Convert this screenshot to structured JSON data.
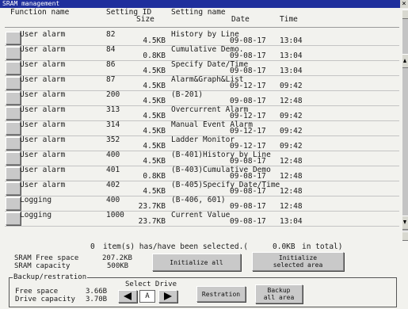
{
  "window": {
    "title": "SRAM management",
    "close_label": "×"
  },
  "header": {
    "function_name": "Function name",
    "setting_id": "Setting ID",
    "size": "Size",
    "setting_name": "Setting name",
    "date": "Date",
    "time": "Time"
  },
  "rows": [
    {
      "function": "User alarm",
      "id": "82",
      "size": "4.5KB",
      "name": "History by Line",
      "date": "09-08-17",
      "time": "13:04"
    },
    {
      "function": "User alarm",
      "id": "84",
      "size": "0.8KB",
      "name": "Cumulative Demo.",
      "date": "09-08-17",
      "time": "13:04"
    },
    {
      "function": "User alarm",
      "id": "86",
      "size": "4.5KB",
      "name": "Specify Date/Time",
      "date": "09-08-17",
      "time": "13:04"
    },
    {
      "function": "User alarm",
      "id": "87",
      "size": "4.5KB",
      "name": "Alarm&Graph&List",
      "date": "09-12-17",
      "time": "09:42"
    },
    {
      "function": "User alarm",
      "id": "200",
      "size": "4.5KB",
      "name": "(B-201)",
      "date": "09-08-17",
      "time": "12:48"
    },
    {
      "function": "User alarm",
      "id": "313",
      "size": "4.5KB",
      "name": "Overcurrent Alarm",
      "date": "09-12-17",
      "time": "09:42"
    },
    {
      "function": "User alarm",
      "id": "314",
      "size": "4.5KB",
      "name": "Manual Event Alarm",
      "date": "09-12-17",
      "time": "09:42"
    },
    {
      "function": "User alarm",
      "id": "352",
      "size": "4.5KB",
      "name": "Ladder Monitor",
      "date": "09-12-17",
      "time": "09:42"
    },
    {
      "function": "User alarm",
      "id": "400",
      "size": "4.5KB",
      "name": "(B-401)History by Line",
      "date": "09-08-17",
      "time": "12:48"
    },
    {
      "function": "User alarm",
      "id": "401",
      "size": "0.8KB",
      "name": "(B-403)Cumulative Demo",
      "date": "09-08-17",
      "time": "12:48"
    },
    {
      "function": "User alarm",
      "id": "402",
      "size": "4.5KB",
      "name": "(B-405)Specify Date/Time",
      "date": "09-08-17",
      "time": "12:48"
    },
    {
      "function": "Logging",
      "id": "400",
      "size": "23.7KB",
      "name": "(B-406, 601)",
      "date": "09-08-17",
      "time": "12:48"
    },
    {
      "function": "Logging",
      "id": "1000",
      "size": "23.7KB",
      "name": "Current Value",
      "date": "09-08-17",
      "time": "13:04"
    }
  ],
  "summary": {
    "selected_count": "0",
    "selected_text": "item(s) has/have been selected.(",
    "selected_size": "0.0KB",
    "selected_suffix": "in total)"
  },
  "sram": {
    "free_label": "SRAM Free space",
    "free_value": "207.2KB",
    "capacity_label": "SRAM capacity",
    "capacity_value": "500KB",
    "initialize_all": "Initialize all",
    "initialize_selected_line1": "Initialize",
    "initialize_selected_line2": "selected area"
  },
  "backup": {
    "group_label": "Backup/restration",
    "free_label": "Free space",
    "free_value": "3.66B",
    "capacity_label": "Drive capacity",
    "capacity_value": "3.70B",
    "select_drive_label": "Select Drive",
    "drive_value": "A",
    "restration_button": "Restration",
    "backup_all_line1": "Backup",
    "backup_all_line2": "all area"
  },
  "colors": {
    "titlebar": "#1f2f9c",
    "background": "#f2f2ee",
    "button": "#c9c9c9"
  }
}
